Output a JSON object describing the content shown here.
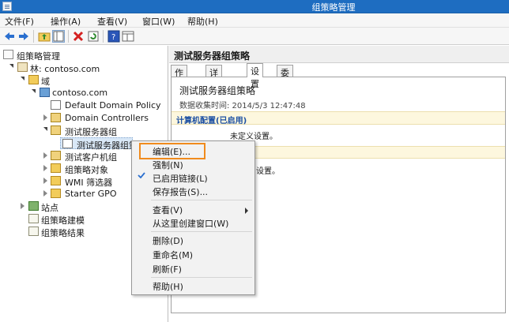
{
  "window": {
    "title": "组策略管理"
  },
  "menubar": [
    "文件(F)",
    "操作(A)",
    "查看(V)",
    "窗口(W)",
    "帮助(H)"
  ],
  "tree": {
    "root": "组策略管理",
    "forest": "林: contoso.com",
    "domains_folder": "域",
    "domain": "contoso.com",
    "items": [
      "Default Domain Policy",
      "Domain Controllers",
      "测试服务器组",
      "测试服务器组策略",
      "测试客户机组",
      "组策略对象",
      "WMI 筛选器",
      "Starter GPO"
    ],
    "sites": "站点",
    "modeling": "组策略建模",
    "results": "组策略结果"
  },
  "right_pane": {
    "header": "测试服务器组策略",
    "tabs": [
      "作用域",
      "详细信息",
      "设置",
      "委派"
    ],
    "active_tab": "设置",
    "gpo_name": "测试服务器组策略",
    "data_collected": "数据收集时间: 2014/5/3 12:47:48",
    "computer_config": "计算机配置(已启用)",
    "undefined_text": "未定义设置。",
    "undefined_partial": "设置。"
  },
  "context_menu": {
    "items": [
      "编辑(E)...",
      "强制(N)",
      "已启用链接(L)",
      "保存报告(S)...",
      "查看(V)",
      "从这里创建窗口(W)",
      "删除(D)",
      "重命名(M)",
      "刷新(F)",
      "帮助(H)"
    ],
    "checked_item": "已启用链接(L)",
    "highlighted_item": "编辑(E)..."
  },
  "colors": {
    "titlebar": "#1e6dc1",
    "highlight": "#f08b1d",
    "link_blue": "#1b4fa3"
  }
}
